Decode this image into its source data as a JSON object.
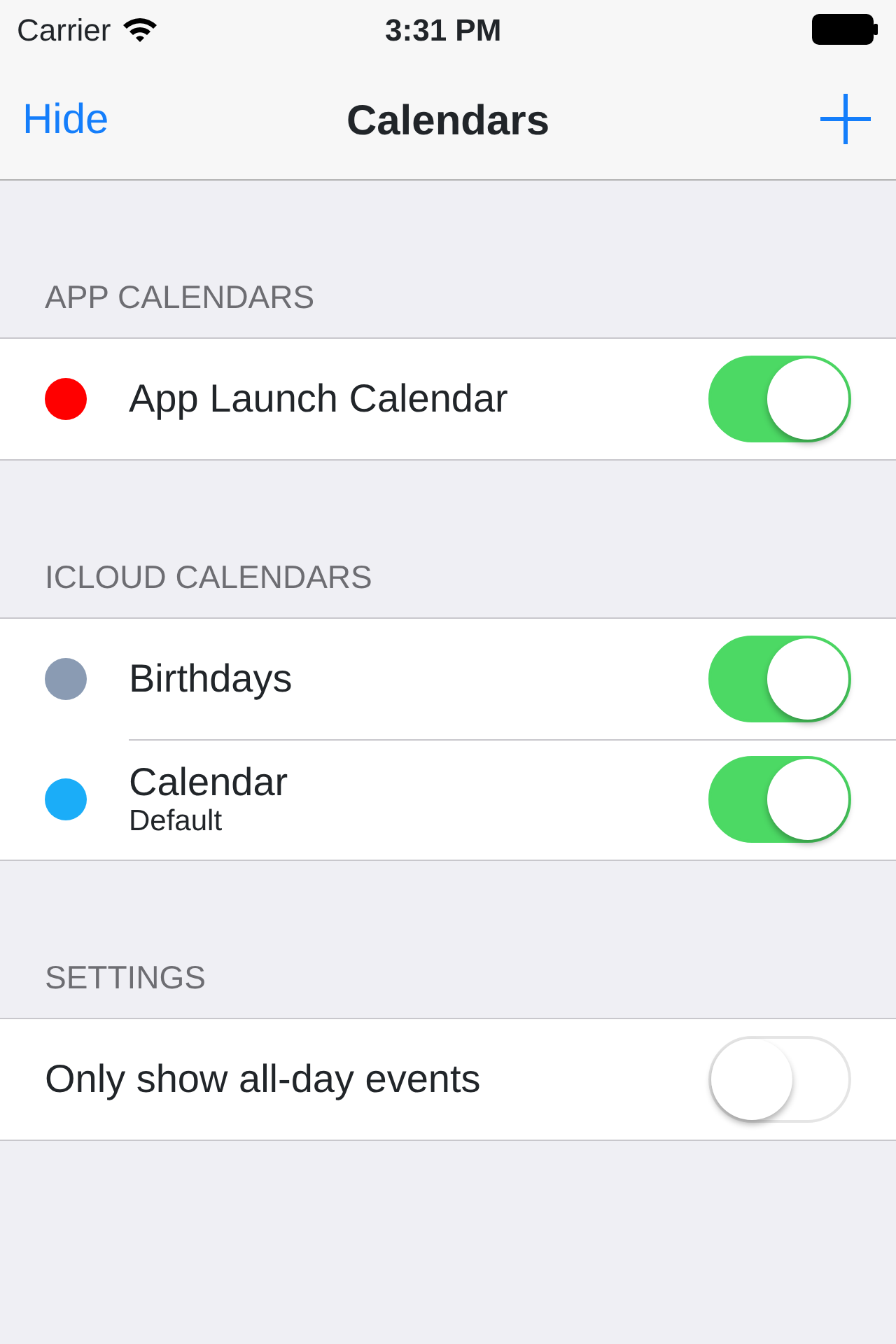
{
  "status_bar": {
    "carrier": "Carrier",
    "time": "3:31 PM"
  },
  "nav_bar": {
    "left_button": "Hide",
    "title": "Calendars"
  },
  "sections": [
    {
      "header": "APP CALENDARS",
      "rows": [
        {
          "kind": "calendar",
          "label": "App Launch Calendar",
          "color": "#ff0000",
          "on": true
        }
      ]
    },
    {
      "header": "ICLOUD CALENDARS",
      "rows": [
        {
          "kind": "calendar",
          "label": "Birthdays",
          "color": "#8a9bb3",
          "on": true
        },
        {
          "kind": "calendar",
          "label": "Calendar",
          "subtitle": "Default",
          "color": "#1badf8",
          "on": true
        }
      ]
    },
    {
      "header": "SETTINGS",
      "rows": [
        {
          "kind": "setting",
          "label": "Only show all-day events",
          "on": false
        }
      ]
    }
  ]
}
